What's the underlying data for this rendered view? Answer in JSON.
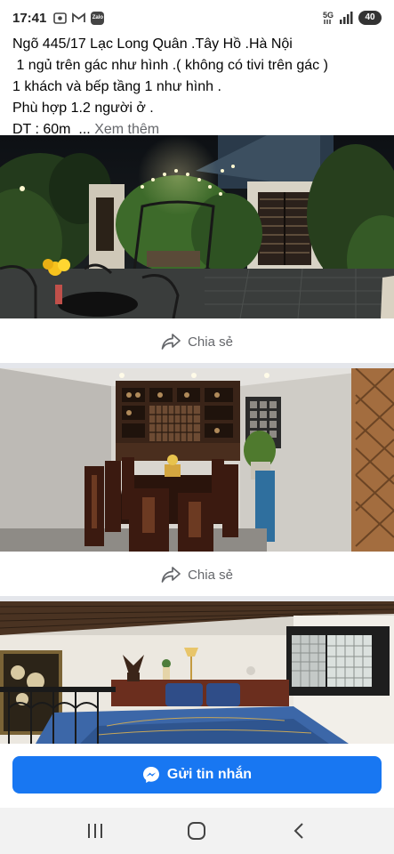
{
  "status_bar": {
    "time": "17:41",
    "app_icons": [
      "screen-record-icon",
      "gmail-icon",
      "zalo-icon"
    ],
    "zalo_label": "Zalo",
    "network_label": "5G",
    "battery": "40"
  },
  "post": {
    "lines": [
      "Ngõ 445/17 Lạc Long Quân .Tây Hồ .Hà Nội",
      " 1 ngủ trên gác như hình .( không có tivi trên gác )",
      "1 khách và bếp tầng 1 như hình .",
      "Phù hợp 1.2 người ở .",
      "DT : 60m  ..."
    ],
    "see_more": "Xem thêm"
  },
  "photos": [
    {
      "name": "rooftop-garden-night-photo"
    },
    {
      "name": "dining-room-photo"
    },
    {
      "name": "bedroom-photo"
    }
  ],
  "share": {
    "label": "Chia sẻ",
    "icon": "share-arrow-icon"
  },
  "cta": {
    "send_message_label": "Gửi tin nhắn",
    "icon": "messenger-icon",
    "color": "#1877f2"
  },
  "nav": {
    "items": [
      "recent-apps-icon",
      "home-icon",
      "back-icon"
    ]
  }
}
